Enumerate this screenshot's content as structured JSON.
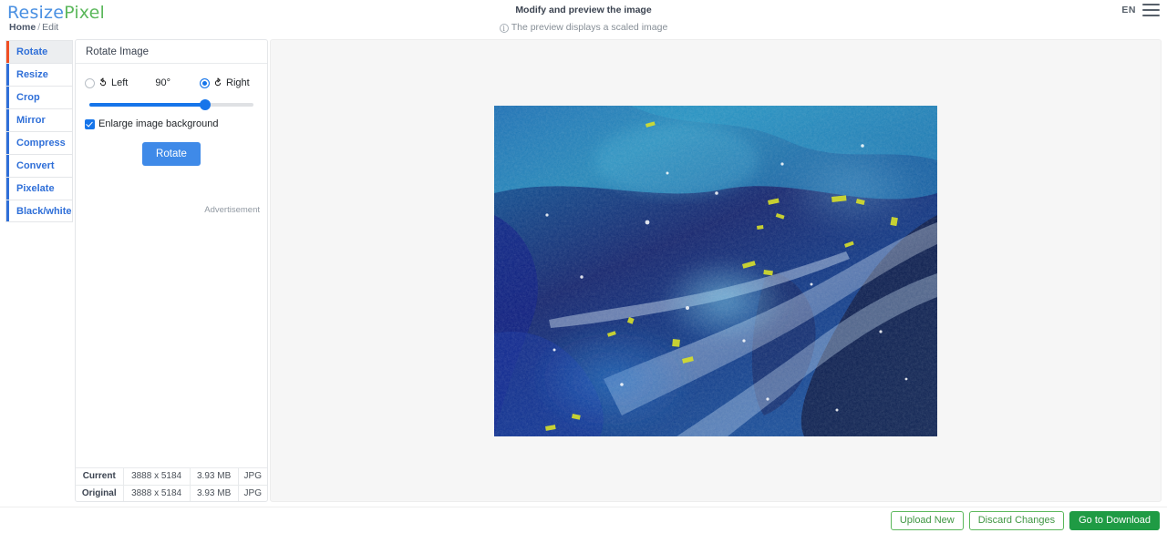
{
  "header": {
    "logo_part_a": "Resize",
    "logo_part_b": "Pixel",
    "logo_color_a": "#4a90e2",
    "logo_color_b": "#5cb85c",
    "breadcrumb_home": "Home",
    "breadcrumb_sep": "/",
    "breadcrumb_current": "Edit",
    "title": "Modify and preview the image",
    "subtitle": "The preview displays a scaled image",
    "info_icon_glyph": "i",
    "language": "EN",
    "menu_icon": "hamburger-menu-icon"
  },
  "sidebar": {
    "items": [
      {
        "label": "Rotate",
        "active": true
      },
      {
        "label": "Resize",
        "active": false
      },
      {
        "label": "Crop",
        "active": false
      },
      {
        "label": "Mirror",
        "active": false
      },
      {
        "label": "Compress",
        "active": false
      },
      {
        "label": "Convert",
        "active": false
      },
      {
        "label": "Pixelate",
        "active": false
      },
      {
        "label": "Black/white",
        "active": false
      }
    ],
    "active_accent_color": "#f04f23",
    "accent_color": "#2f6fd8"
  },
  "panel": {
    "title": "Rotate Image",
    "direction_left_label": "Left",
    "direction_left_icon": "rotate-counterclockwise-icon",
    "direction_left_selected": false,
    "angle_label": "90°",
    "direction_right_label": "Right",
    "direction_right_icon": "rotate-clockwise-icon",
    "direction_right_selected": true,
    "slider_value_percent": 73,
    "enlarge_label": "Enlarge image background",
    "enlarge_checked": true,
    "rotate_button_label": "Rotate",
    "rotate_button_color": "#3f8ae8",
    "ad_label": "Advertisement"
  },
  "info_table": {
    "rows": [
      {
        "label": "Current",
        "dimensions": "3888 x 5184",
        "size": "3.93 MB",
        "format": "JPG"
      },
      {
        "label": "Original",
        "dimensions": "3888 x 5184",
        "size": "3.93 MB",
        "format": "JPG"
      }
    ]
  },
  "preview": {
    "image_alt": "abstract-blue-nebula-painting"
  },
  "footer": {
    "upload_new_label": "Upload New",
    "discard_changes_label": "Discard Changes",
    "go_to_download_label": "Go to Download",
    "ghost_color": "#5cb85c",
    "solid_color": "#1f9b44"
  }
}
